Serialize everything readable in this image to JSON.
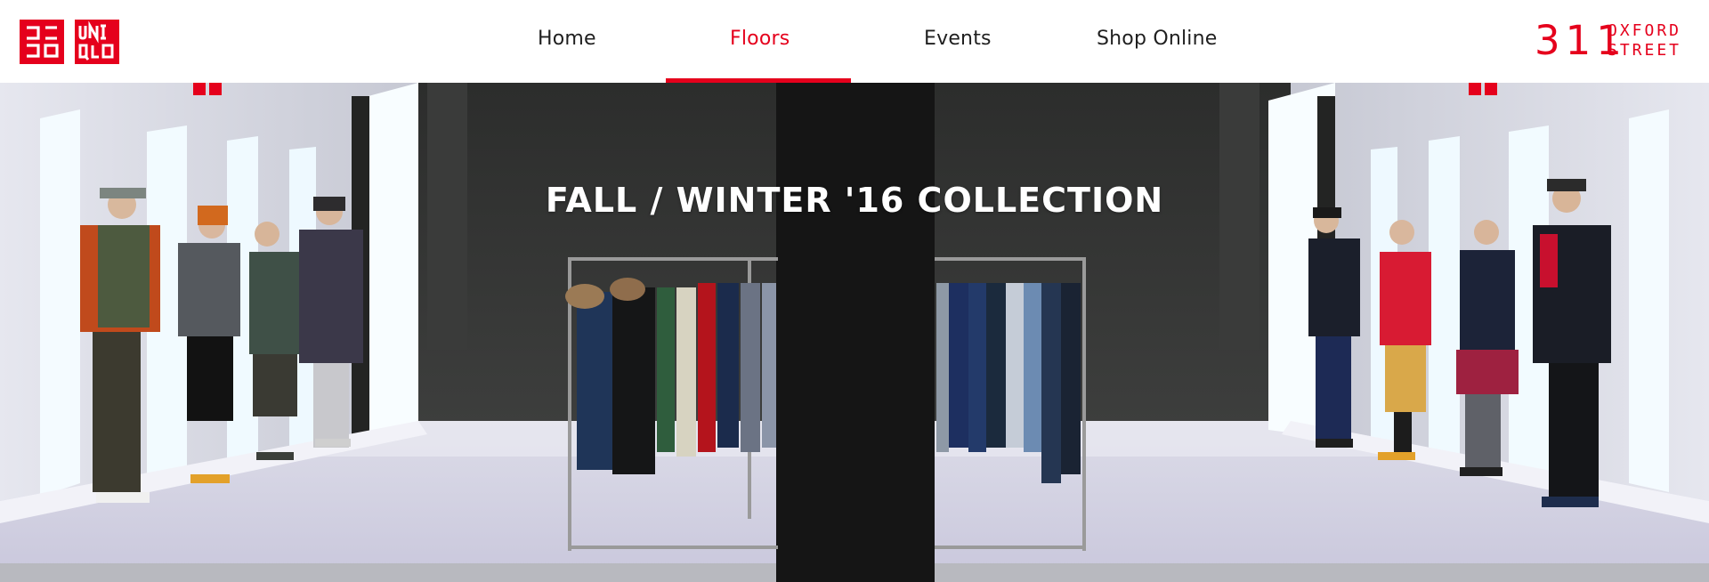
{
  "brand": {
    "logo_left_text": "ユニクロ",
    "logo_right_text": "UNIQLO",
    "accent_color": "#e5001c"
  },
  "nav": {
    "items": [
      {
        "label": "Home",
        "active": false
      },
      {
        "label": "Floors",
        "active": true
      },
      {
        "label": "Events",
        "active": false
      },
      {
        "label": "Shop Online",
        "active": false
      }
    ]
  },
  "store": {
    "number": "311",
    "street_line1": "OXFORD",
    "street_line2": "STREET"
  },
  "hero": {
    "title": "FALL / WINTER '16 COLLECTION",
    "image_description_icon": "store-interior-photo"
  }
}
